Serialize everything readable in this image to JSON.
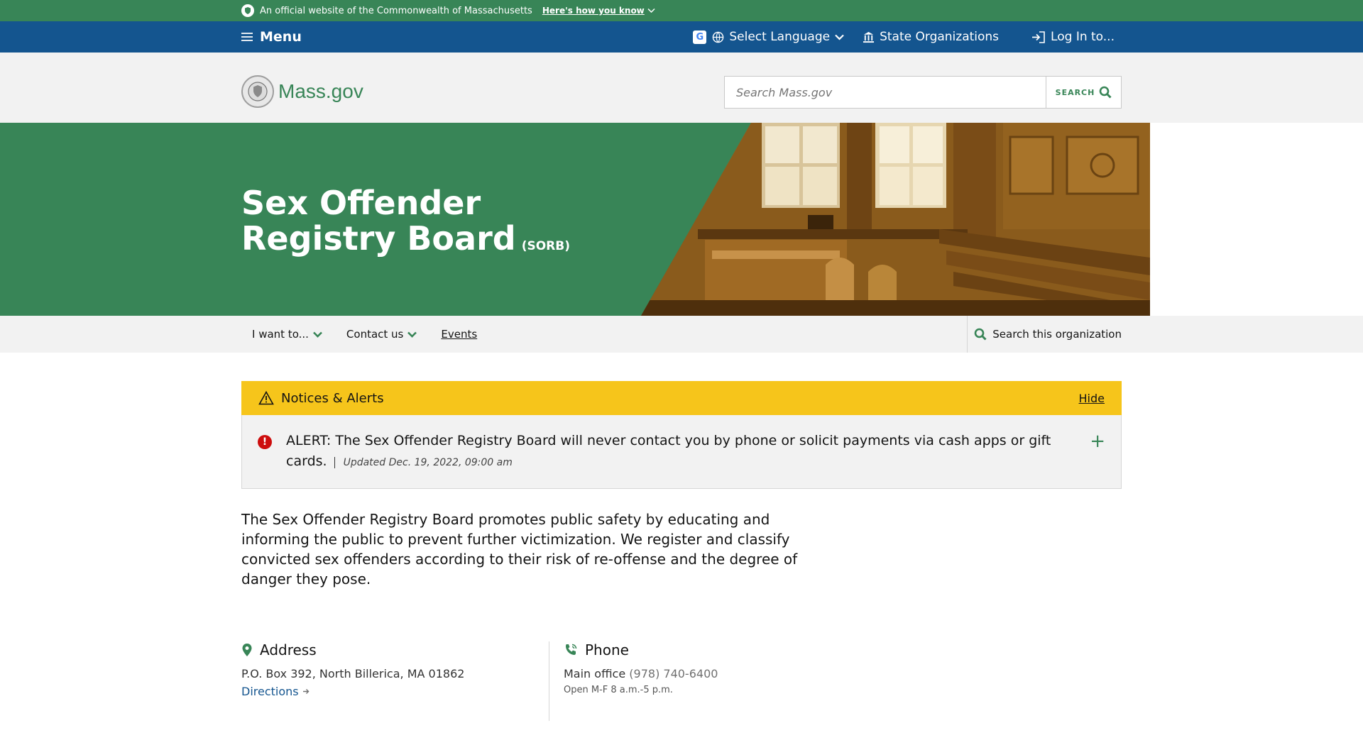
{
  "official_bar": {
    "text": "An official website of the Commonwealth of Massachusetts",
    "link": "Here's how you know"
  },
  "util_nav": {
    "menu": "Menu",
    "language": "Select Language",
    "state_orgs": "State Organizations",
    "login": "Log In to..."
  },
  "header": {
    "logo_text": "Mass.gov",
    "search_placeholder": "Search Mass.gov",
    "search_button": "SEARCH"
  },
  "hero": {
    "title": "Sex Offender Registry Board",
    "abbr": "(SORB)"
  },
  "org_nav": {
    "items": [
      "I want to...",
      "Contact us",
      "Events"
    ],
    "search": "Search this organization"
  },
  "alerts": {
    "heading": "Notices & Alerts",
    "hide": "Hide",
    "message": "ALERT: The Sex Offender Registry Board will never contact you by phone or solicit payments via cash apps or gift cards.",
    "updated": "Updated Dec. 19, 2022, 09:00 am"
  },
  "description": "The Sex Offender Registry Board promotes public safety by educating and informing the public to prevent further victimization. We register and classify convicted sex offenders according to their risk of re-offense and the degree of danger they pose.",
  "contact": {
    "address_heading": "Address",
    "address": "P.O. Box 392, North Billerica, MA 01862",
    "directions": "Directions",
    "phone_heading": "Phone",
    "phone_label": "Main office",
    "phone_number": "(978) 740-6400",
    "hours": "Open M-F 8 a.m.-5 p.m."
  },
  "colors": {
    "green": "#388557",
    "blue": "#14558f",
    "alert_yellow": "#f6c51b",
    "alert_red": "#cd0d0d"
  }
}
